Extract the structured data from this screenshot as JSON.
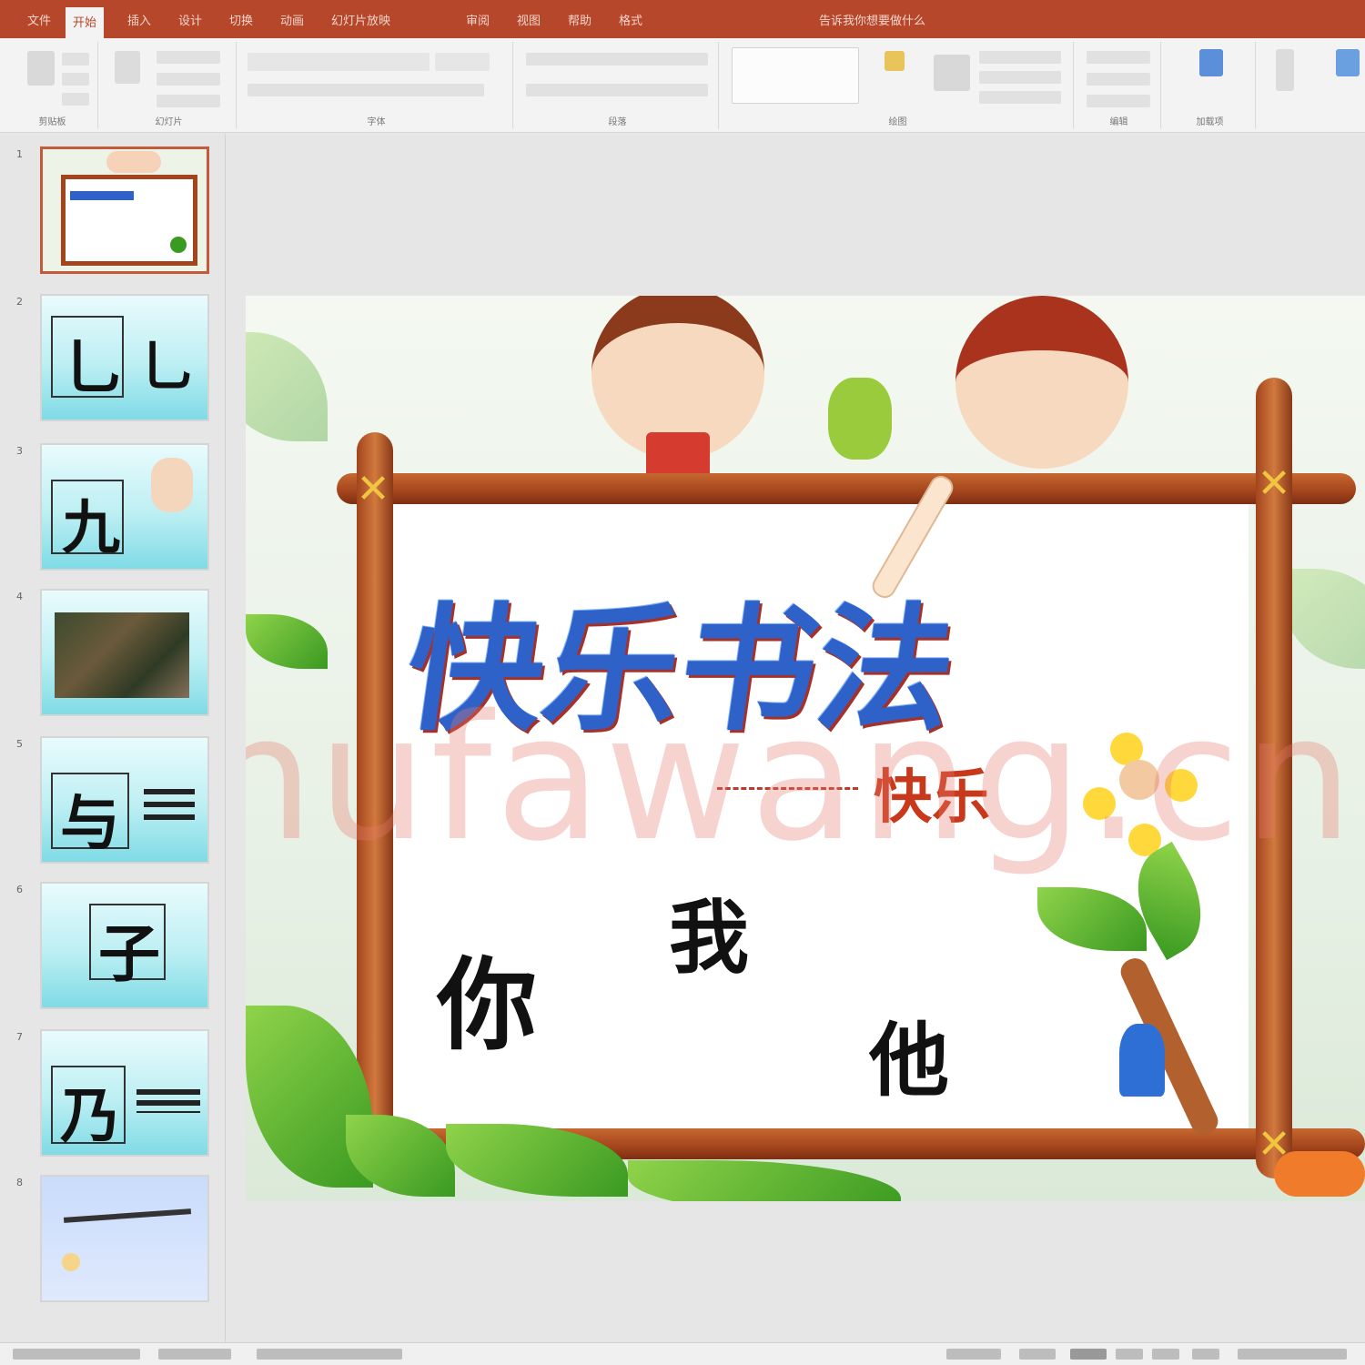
{
  "ribbon": {
    "tabs": [
      "文件",
      "开始",
      "插入",
      "设计",
      "切换",
      "动画",
      "幻灯片放映",
      "审阅",
      "视图",
      "帮助",
      "格式",
      "告诉我你想要做什么"
    ],
    "active_tab": "开始",
    "groups": [
      "剪贴板",
      "幻灯片",
      "字体",
      "段落",
      "绘图",
      "编辑",
      "加载项"
    ]
  },
  "thumbnails": [
    {
      "num": "1",
      "kind": "cover",
      "selected": true
    },
    {
      "num": "2",
      "chars": [
        "乚",
        "乚"
      ]
    },
    {
      "num": "3",
      "chars": [
        "九"
      ]
    },
    {
      "num": "4",
      "kind": "photo"
    },
    {
      "num": "5",
      "chars": [
        "与"
      ]
    },
    {
      "num": "6",
      "chars": [
        "子"
      ]
    },
    {
      "num": "7",
      "chars": [
        "乃"
      ]
    },
    {
      "num": "8",
      "kind": "blue"
    }
  ],
  "slide": {
    "title_chars": [
      "快",
      "乐",
      "书",
      "法"
    ],
    "subtitle": "快乐",
    "pronouns": [
      "你",
      "我",
      "他"
    ],
    "watermark": "Shufawang.cn"
  },
  "colors": {
    "accent": "#b7472a",
    "title_blue": "#2f62c8",
    "subtitle_red": "#c8391b"
  }
}
